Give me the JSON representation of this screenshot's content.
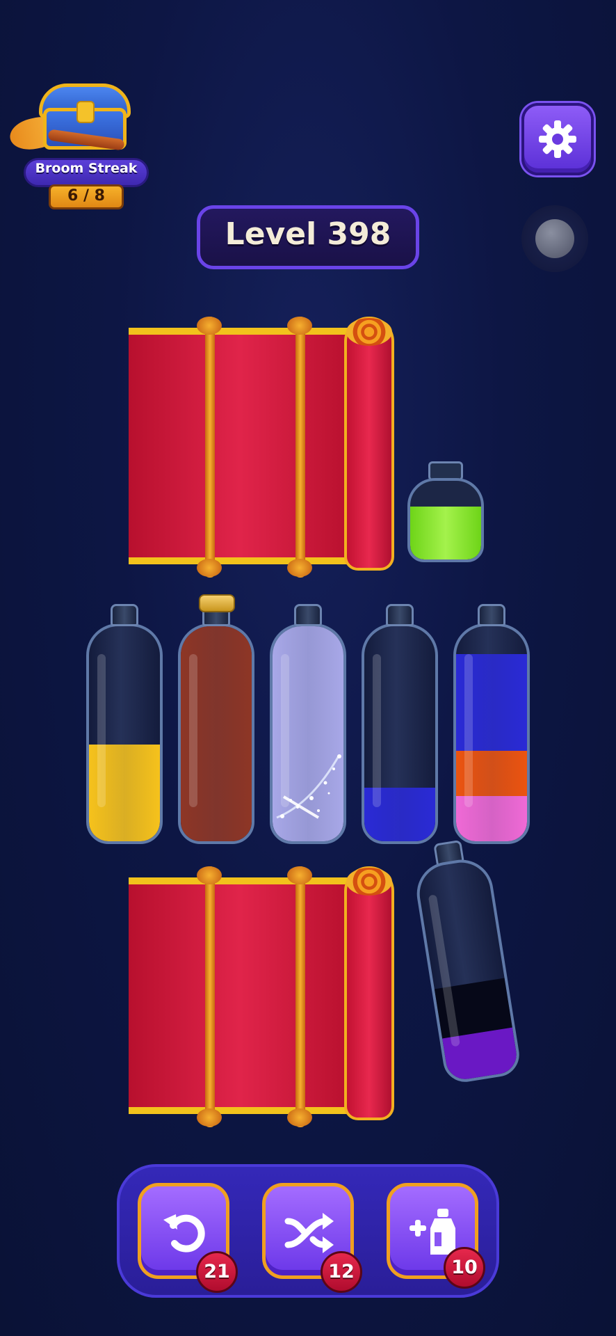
{
  "streak": {
    "label": "Broom Streak",
    "count": "6 / 8"
  },
  "level": {
    "title": "Level 398"
  },
  "colors": {
    "yellow": "#f6c21c",
    "brown": "#8e3626",
    "lavender": "#a8a8e8",
    "blue": "#2a2ad6",
    "orange": "#ec5410",
    "pink": "#f06ad6",
    "green": "#8ee434",
    "black": "#060818",
    "purple": "#6a18c4",
    "curtain_red": "#d81e40",
    "toolbar_blue": "#3428b8"
  },
  "bottles": [
    {
      "name": "bottle-1",
      "layers": [
        {
          "color": "yellow",
          "fraction": 0.45
        }
      ]
    },
    {
      "name": "bottle-2",
      "corked": true,
      "layers": [
        {
          "color": "brown",
          "fraction": 1.0
        }
      ]
    },
    {
      "name": "bottle-3",
      "layers": [
        {
          "color": "lavender",
          "fraction": 1.0
        }
      ]
    },
    {
      "name": "bottle-4",
      "layers": [
        {
          "color": "blue",
          "fraction": 0.25
        }
      ]
    },
    {
      "name": "bottle-5",
      "layers": [
        {
          "color": "pink",
          "fraction": 0.21
        },
        {
          "color": "orange",
          "fraction": 0.21
        },
        {
          "color": "blue",
          "fraction": 0.45
        }
      ]
    }
  ],
  "jar": {
    "color": "green",
    "fraction": 0.65
  },
  "tilted_bottle": {
    "layers": [
      {
        "color": "purple",
        "fraction": 0.21
      },
      {
        "color": "black",
        "fraction": 0.24
      }
    ]
  },
  "icons": {
    "settings": "gear-icon",
    "undo": "undo-icon",
    "shuffle": "shuffle-icon",
    "add_bottle": "add-bottle-icon"
  },
  "toolbar": {
    "undo_count": "21",
    "shuffle_count": "12",
    "add_bottle_count": "10"
  }
}
